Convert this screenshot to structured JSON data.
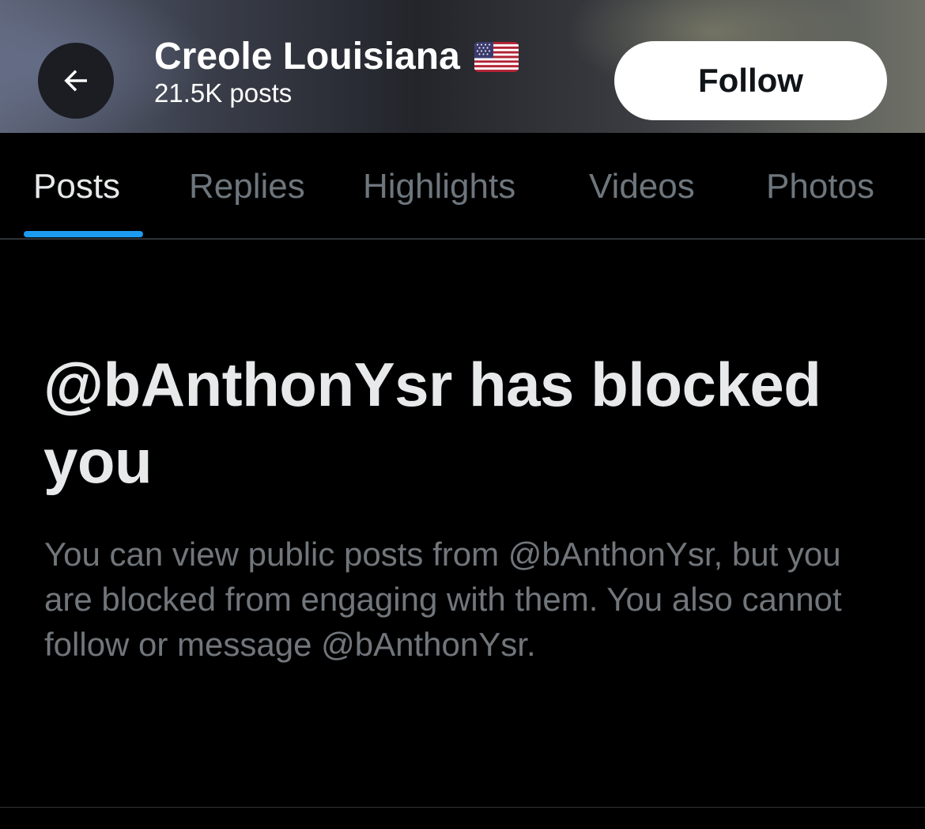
{
  "header": {
    "title": "Creole Louisiana",
    "flag_emoji_name": "us-flag-icon",
    "post_count": "21.5K posts",
    "back_icon": "arrow-left-icon",
    "follow_label": "Follow"
  },
  "tabs": [
    {
      "label": "Posts",
      "active": true
    },
    {
      "label": "Replies",
      "active": false
    },
    {
      "label": "Highlights",
      "active": false
    },
    {
      "label": "Videos",
      "active": false
    },
    {
      "label": "Photos",
      "active": false
    }
  ],
  "blocked": {
    "heading": "@bAnthonYsr has blocked you",
    "body": "You can view public posts from @bAnthonYsr, but you are blocked from engaging with them. You also cannot follow or message @bAnthonYsr."
  },
  "colors": {
    "background": "#000000",
    "accent": "#1d9bf0",
    "active_tab": "#e7e9ea",
    "inactive_tab": "#6e767d",
    "secondary_text": "#71767b"
  }
}
